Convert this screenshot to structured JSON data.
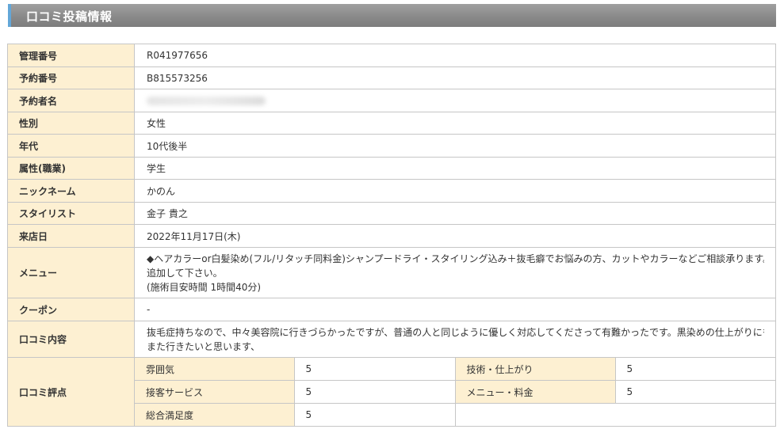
{
  "header": {
    "title": "口コミ投稿情報"
  },
  "rows": {
    "kanri": {
      "label": "管理番号",
      "value": "R041977656"
    },
    "yoyaku_no": {
      "label": "予約番号",
      "value": "B815573256"
    },
    "yoyakusha": {
      "label": "予約者名",
      "value": ""
    },
    "seibetsu": {
      "label": "性別",
      "value": "女性"
    },
    "nendai": {
      "label": "年代",
      "value": "10代後半"
    },
    "zokusei": {
      "label": "属性(職業)",
      "value": "学生"
    },
    "nickname": {
      "label": "ニックネーム",
      "value": "かのん"
    },
    "stylist": {
      "label": "スタイリスト",
      "value": "金子 貴之"
    },
    "raiten": {
      "label": "来店日",
      "value": "2022年11月17日(木)"
    },
    "menu": {
      "label": "メニュー",
      "line1": "◆ヘアカラーor白髪染め(フル/リタッチ同料金)シャンプードライ・スタイリング込み＋抜毛癖でお悩みの方、カットやカラーなどご相談承ります。メニューに",
      "line2": "追加して下さい。",
      "line3": "(施術目安時間 1時間40分)"
    },
    "coupon": {
      "label": "クーポン",
      "value": "-"
    },
    "kuchikomi": {
      "label": "口コミ内容",
      "line1": "抜毛症持ちなので、中々美容院に行きづらかったですが、普通の人と同じように優しく対応してくださって有難かったです。黒染めの仕上がりにも満足なので",
      "line2": "また行きたいと思います、"
    },
    "hyoka": {
      "label": "口コミ評点",
      "fun_label": "雰囲気",
      "fun_value": "5",
      "gijutsu_label": "技術・仕上がり",
      "gijutsu_value": "5",
      "sekkyaku_label": "接客サービス",
      "sekkyaku_value": "5",
      "menu_ryokin_label": "メニュー・料金",
      "menu_ryokin_value": "5",
      "sogo_label": "総合満足度",
      "sogo_value": "5"
    }
  }
}
